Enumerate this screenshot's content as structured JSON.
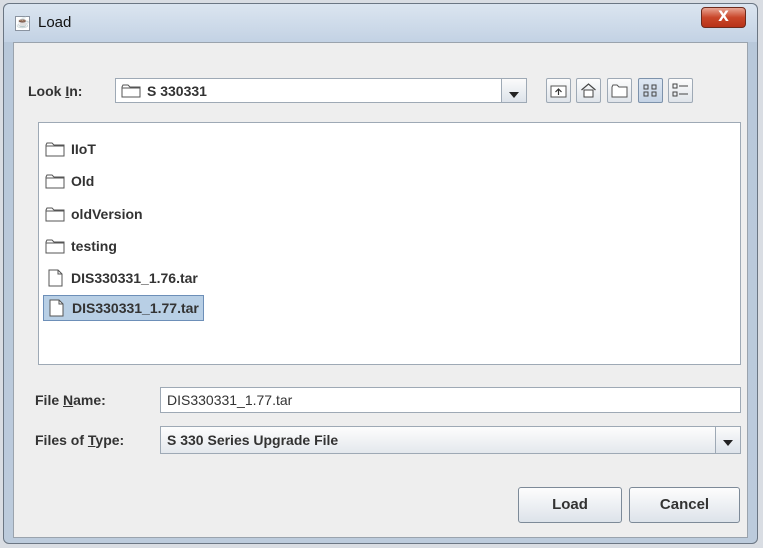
{
  "window": {
    "title": "Load",
    "close_label": "X"
  },
  "look_in": {
    "label_prefix": "Look ",
    "label_mnemonic": "I",
    "label_suffix": "n:",
    "value": "S 330331"
  },
  "toolbar": {
    "buttons": [
      {
        "name": "up-one-level",
        "icon": "folder-up-icon"
      },
      {
        "name": "home",
        "icon": "home-icon"
      },
      {
        "name": "create-new-folder",
        "icon": "new-folder-icon"
      },
      {
        "name": "list-view",
        "icon": "list-view-icon",
        "active": true
      },
      {
        "name": "details-view",
        "icon": "details-view-icon"
      }
    ]
  },
  "files": [
    {
      "name": "IIoT",
      "type": "folder"
    },
    {
      "name": "Old",
      "type": "folder"
    },
    {
      "name": "oldVersion",
      "type": "folder"
    },
    {
      "name": "testing",
      "type": "folder"
    },
    {
      "name": "DIS330331_1.76.tar",
      "type": "file"
    },
    {
      "name": "DIS330331_1.77.tar",
      "type": "file",
      "selected": true
    }
  ],
  "file_name": {
    "label_prefix": "File ",
    "label_mnemonic": "N",
    "label_suffix": "ame:",
    "value": "DIS330331_1.77.tar"
  },
  "file_type": {
    "label_prefix": "Files of ",
    "label_mnemonic": "T",
    "label_suffix": "ype:",
    "value": "S 330 Series Upgrade File"
  },
  "buttons": {
    "load": "Load",
    "cancel": "Cancel"
  }
}
